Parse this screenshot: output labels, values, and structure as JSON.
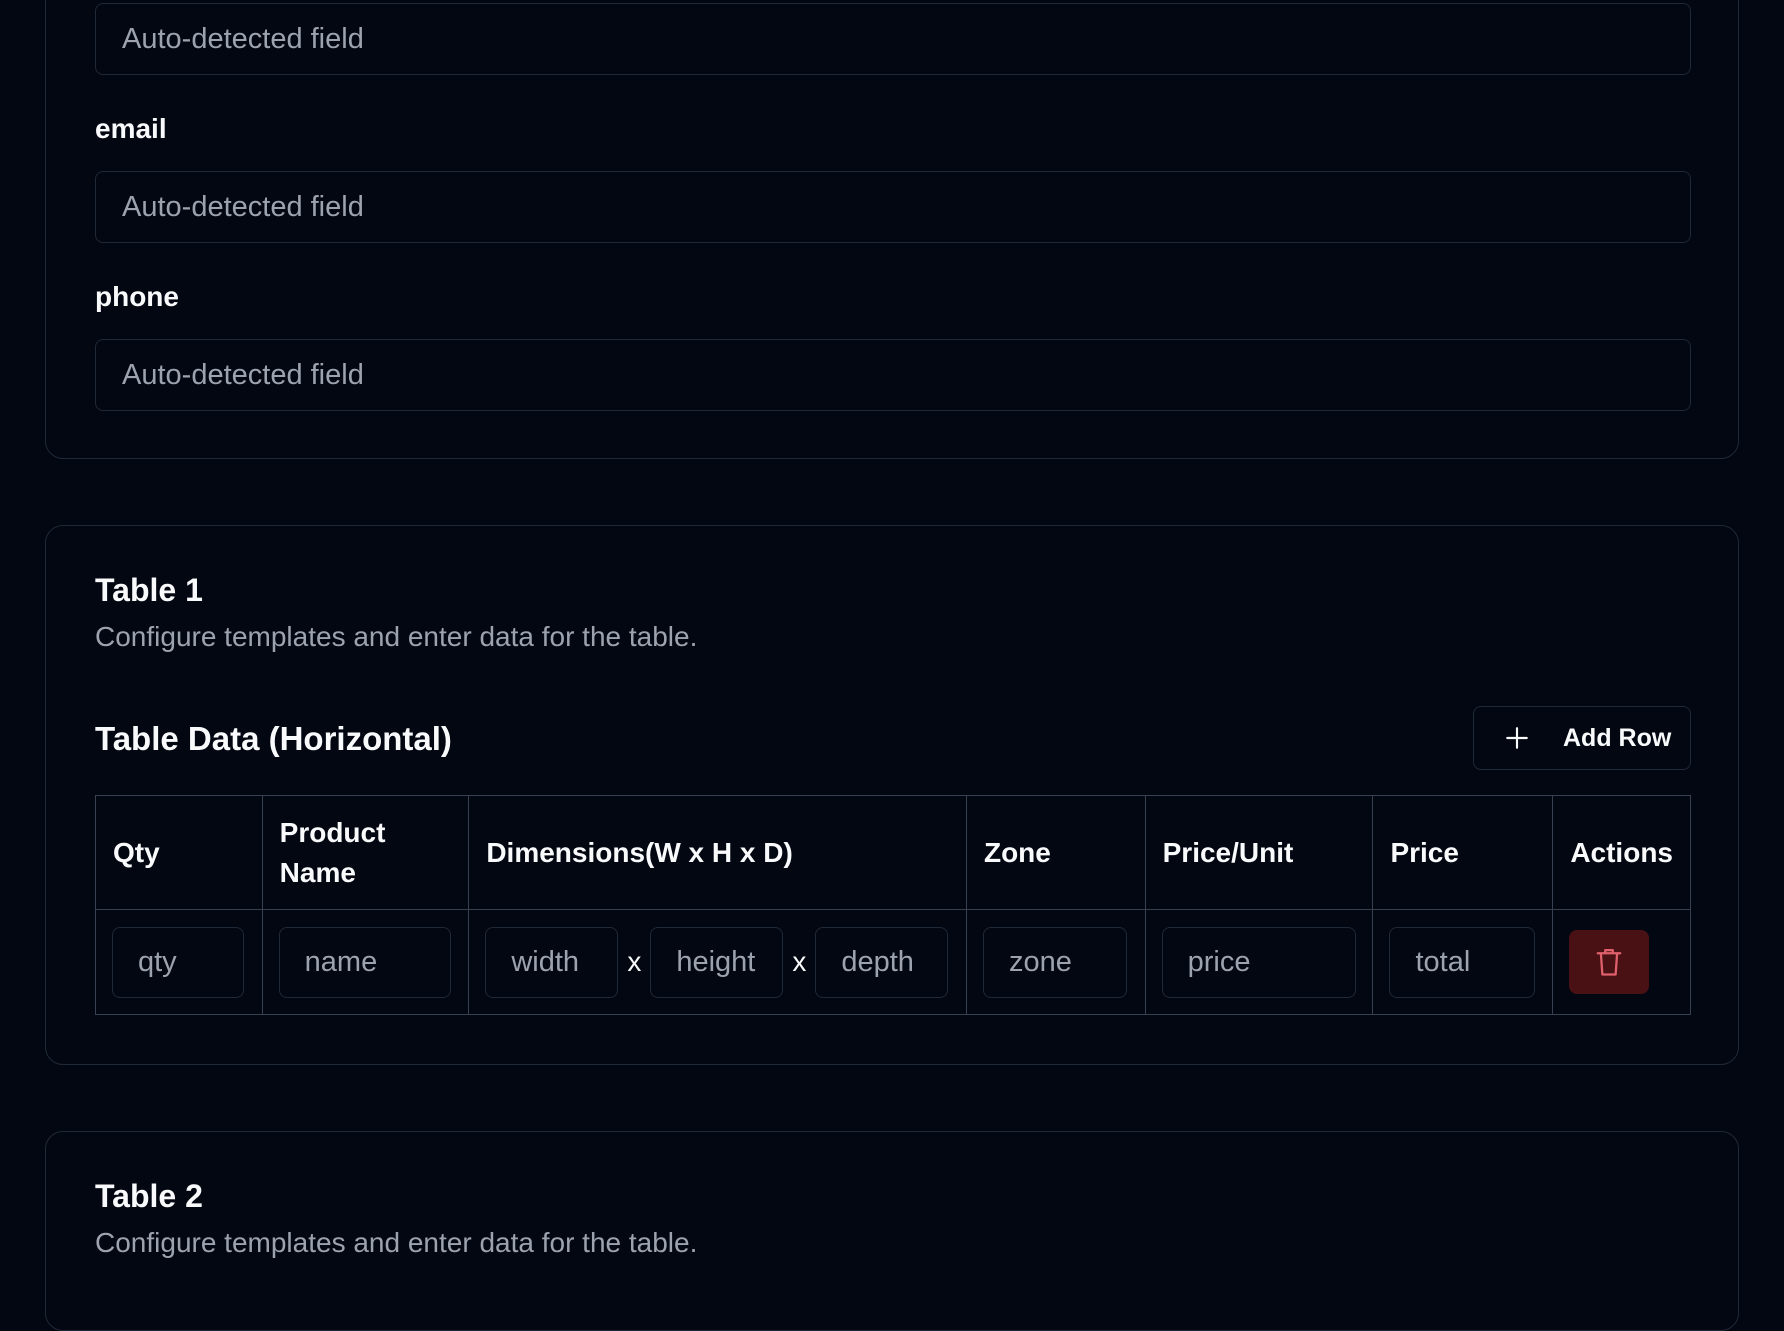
{
  "contact_card": {
    "fields": [
      {
        "label": "",
        "placeholder": "Auto-detected field"
      },
      {
        "label": "email",
        "placeholder": "Auto-detected field"
      },
      {
        "label": "phone",
        "placeholder": "Auto-detected field"
      }
    ]
  },
  "table1": {
    "title": "Table 1",
    "description": "Configure templates and enter data for the table.",
    "section_title": "Table Data (Horizontal)",
    "add_row_label": "Add Row",
    "columns": [
      "Qty",
      "Product Name",
      "Dimensions(W x H x D)",
      "Zone",
      "Price/Unit",
      "Price",
      "Actions"
    ],
    "row": {
      "qty": "qty",
      "name": "name",
      "width": "width",
      "height": "height",
      "depth": "depth",
      "separator": "x",
      "zone": "zone",
      "price": "price",
      "total": "total"
    }
  },
  "table2": {
    "title": "Table 2",
    "description": "Configure templates and enter data for the table."
  },
  "colors": {
    "background": "#030712",
    "border": "#1f2937",
    "text": "#f9fafb",
    "muted": "#9ca3af",
    "danger_bg": "#4a1115",
    "danger_icon": "#e0606b"
  },
  "icons": {
    "add_row": "plus-icon",
    "delete": "trash-icon"
  }
}
